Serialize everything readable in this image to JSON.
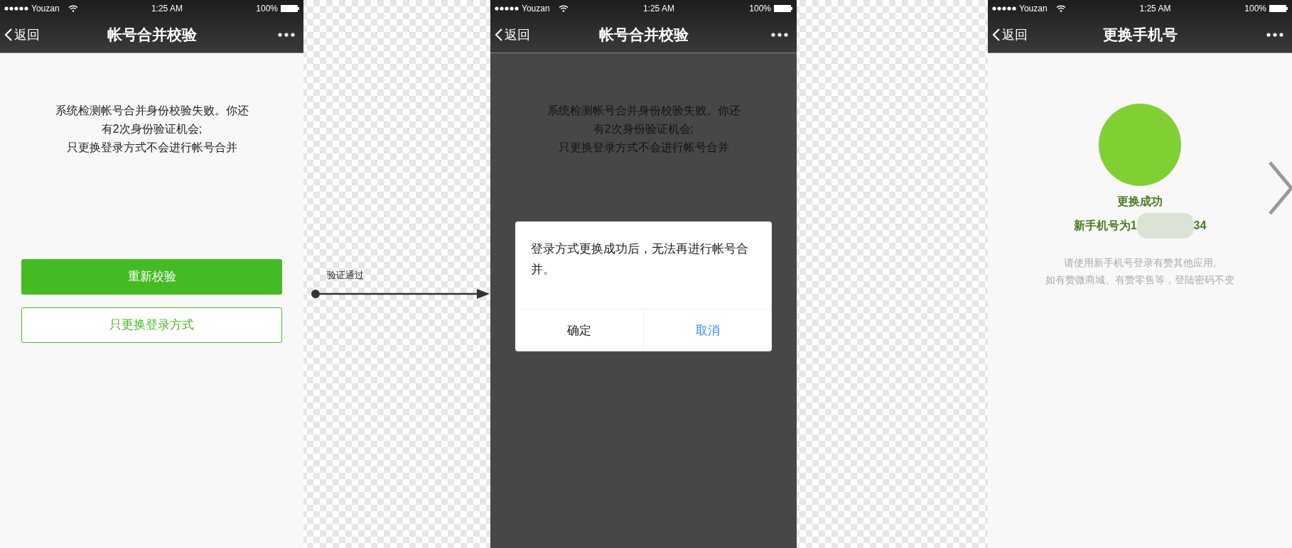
{
  "screens": [
    {
      "kind": "verify",
      "status_bar": {
        "carrier": "Youzan",
        "time": "1:25 AM",
        "battery": "100%"
      },
      "nav": {
        "back": "返回",
        "title": "帐号合并校验"
      },
      "message": [
        "系统检测帐号合并身份校验失败。你还",
        "有2次身份验证机会;",
        "只更换登录方式不会进行帐号合并"
      ],
      "buttons": [
        {
          "label": "重新校验",
          "primary": true
        },
        {
          "label": "只更换登录方式",
          "primary": false
        }
      ]
    },
    {
      "kind": "dialog",
      "status_bar": {
        "carrier": "Youzan",
        "time": "1:25 AM",
        "battery": "100%"
      },
      "nav": {
        "back": "返回",
        "title": "帐号合并校验"
      },
      "message": [
        "系统检测帐号合并身份校验失败。你还",
        "有2次身份验证机会;",
        "只更换登录方式不会进行帐号合并"
      ],
      "dialog": {
        "text": "登录方式更换成功后，无法再进行帐号合并。",
        "buttons": [
          {
            "label": "确定",
            "primary": false
          },
          {
            "label": "取消",
            "primary": true
          }
        ]
      }
    },
    {
      "kind": "success",
      "status_bar": {
        "carrier": "Youzan",
        "time": "1:25 AM",
        "battery": "100%"
      },
      "nav": {
        "back": "返回",
        "title": "更换手机号"
      },
      "result": {
        "title": "更换成功",
        "phone_prefix": "新手机号为1",
        "phone_suffix": "34",
        "hint": [
          "请使用新手机号登录有赞其他应用,",
          "如有赞微商城、有赞零售等，登陆密码不变"
        ]
      }
    }
  ],
  "connector": {
    "label": "验证通过"
  }
}
